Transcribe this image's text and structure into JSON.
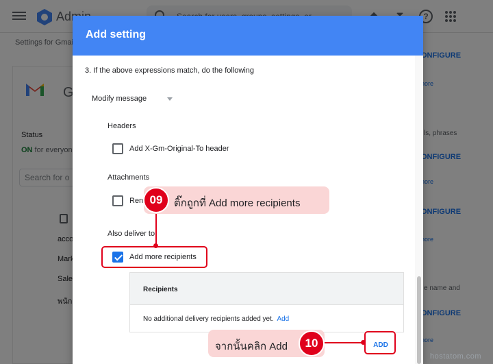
{
  "topbar": {
    "app_name": "Admin",
    "search_placeholder": "Search for users, groups, settings, or..."
  },
  "breadcrumb": "Settings for Gmail",
  "gmail_card": {
    "partial_title": "G",
    "status_label": "Status",
    "status_on": "ON",
    "status_rest": " for everyone",
    "search_placeholder": "Search for o",
    "list_items": [
      "acco",
      "Mark",
      "Sale",
      "พนัก"
    ]
  },
  "right_column": {
    "configure": "ONFIGURE",
    "more": "nore",
    "text_phrases": "ls, phrases",
    "text_name": "e name and"
  },
  "dialog": {
    "title": "Add setting",
    "step_text": "3. If the above expressions match, do the following",
    "action_select": "Modify message",
    "headers_label": "Headers",
    "header_option": "Add X-Gm-Original-To header",
    "attachments_label": "Attachments",
    "attachment_option": "Ren",
    "also_deliver_label": "Also deliver to",
    "add_recipients_option": "Add more recipients",
    "add_recipients_checked": true,
    "recipients_title": "Recipients",
    "recipients_empty": "No additional delivery recipients added yet.",
    "recipients_add_link": "Add",
    "add_button": "ADD"
  },
  "annotations": {
    "step9_number": "09",
    "step9_text": "ติ๊กถูกที่ Add more recipients",
    "step10_number": "10",
    "step10_text": "จากนั้นคลิก Add"
  },
  "watermark": "hostatom.com",
  "colors": {
    "header_blue": "#4285f4",
    "link_blue": "#1a73e8",
    "annotation_red": "#e0001b",
    "callout_pink": "#fad6d6"
  }
}
